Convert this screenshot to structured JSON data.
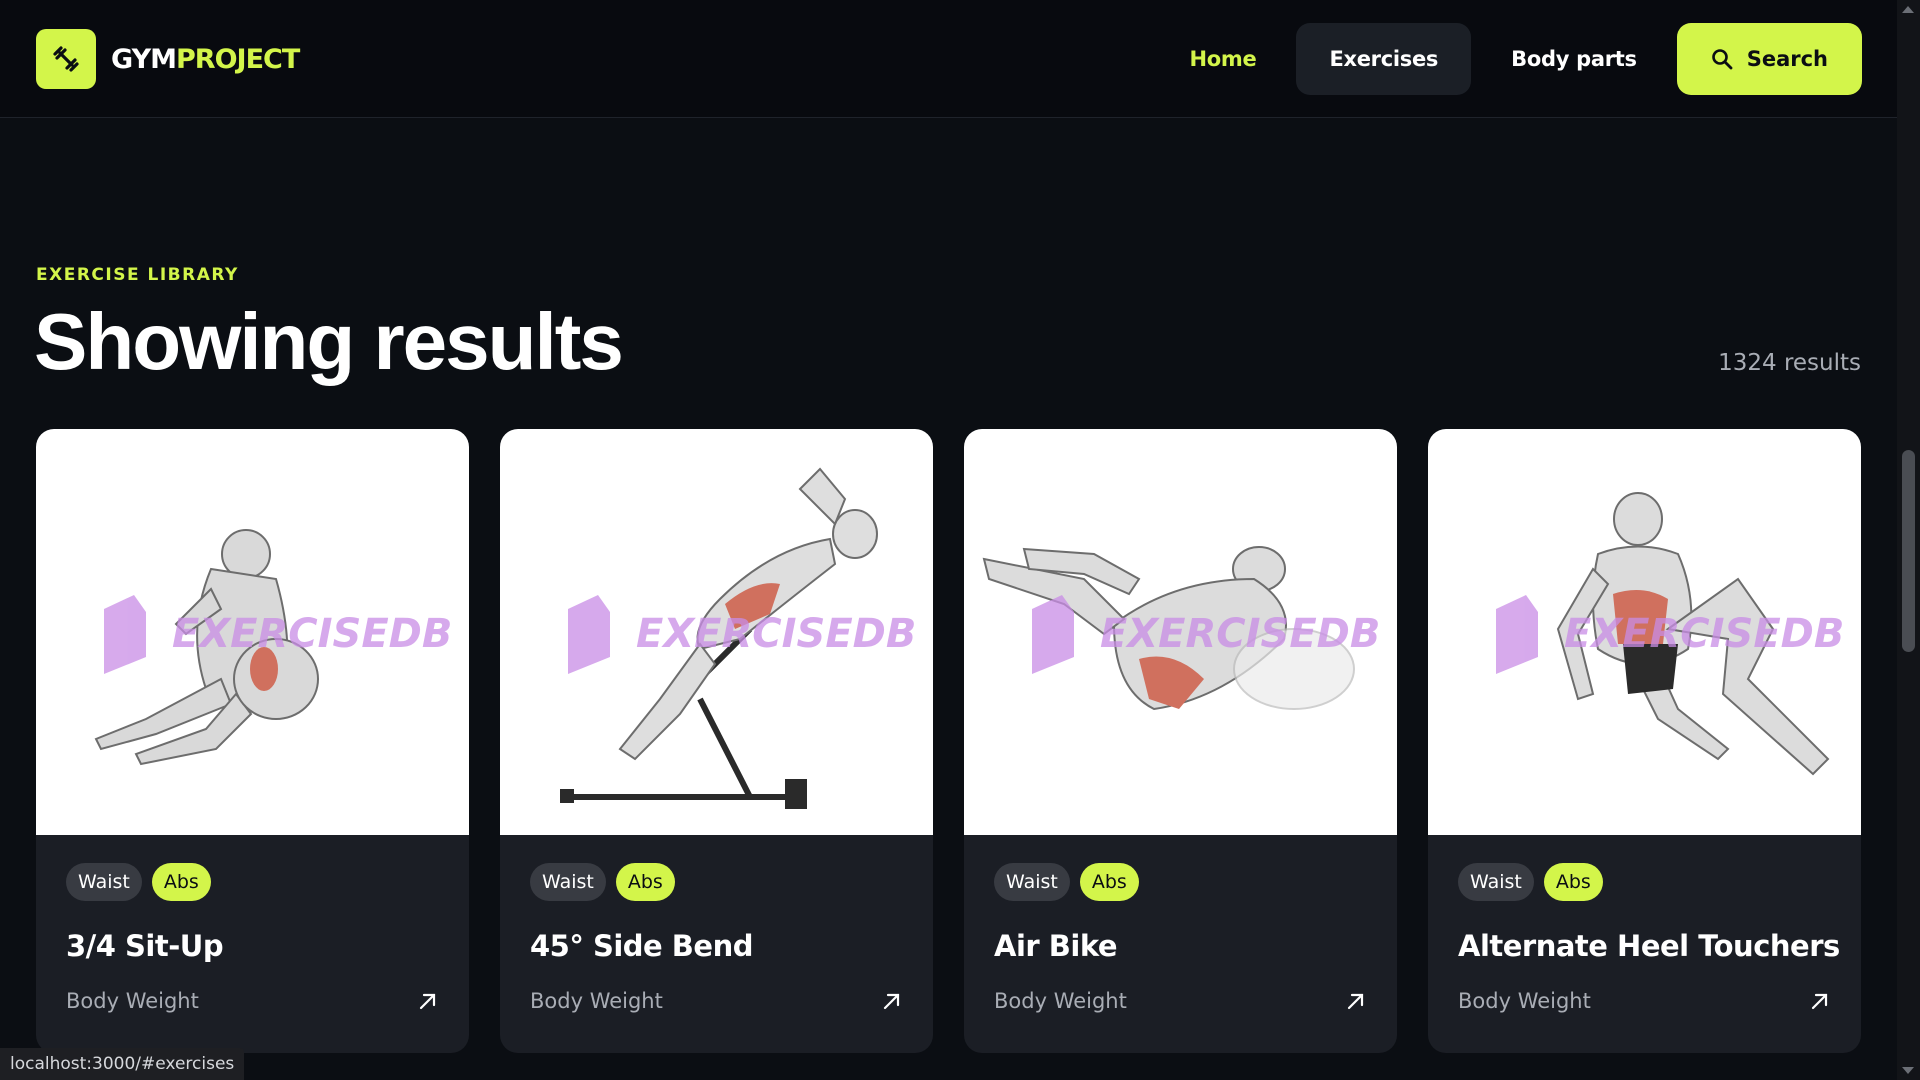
{
  "header": {
    "logo_part1": "GYM",
    "logo_part2": "PROJECT",
    "logo_icon": "dumbbell-icon",
    "nav": [
      {
        "label": "Home",
        "state": "active"
      },
      {
        "label": "Exercises",
        "state": "hovered"
      },
      {
        "label": "Body parts",
        "state": "default"
      }
    ],
    "search_label": "Search",
    "search_icon": "search-icon"
  },
  "hero": {
    "eyebrow": "EXERCISE LIBRARY",
    "title": "Showing results",
    "count": "1324 results"
  },
  "cards": [
    {
      "tags": [
        "Waist",
        "Abs"
      ],
      "title": "3/4 Sit-Up",
      "equipment": "Body Weight",
      "watermark": "EXERCISEDB"
    },
    {
      "tags": [
        "Waist",
        "Abs"
      ],
      "title": "45° Side Bend",
      "equipment": "Body Weight",
      "watermark": "EXERCISEDB"
    },
    {
      "tags": [
        "Waist",
        "Abs"
      ],
      "title": "Air Bike",
      "equipment": "Body Weight",
      "watermark": "EXERCISEDB"
    },
    {
      "tags": [
        "Waist",
        "Abs"
      ],
      "title": "Alternate Heel Touchers",
      "equipment": "Body Weight",
      "watermark": "EXERCISEDB"
    }
  ],
  "status_bar": {
    "url": "localhost:3000/#exercises"
  },
  "colors": {
    "accent": "#d3f54a",
    "background": "#0b0e13",
    "card": "#1b1e25"
  }
}
